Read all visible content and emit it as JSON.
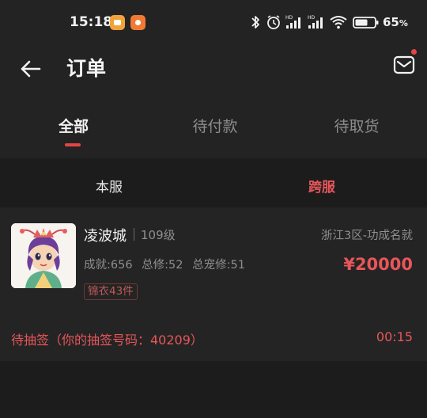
{
  "status_bar": {
    "time": "15:18",
    "battery": "65",
    "icons": [
      "app-notification-icon",
      "app-notification-icon",
      "bluetooth-icon",
      "alarm-icon",
      "hd-signal-icon",
      "hd-signal-icon",
      "wifi-icon",
      "battery-icon"
    ]
  },
  "header": {
    "title": "订单",
    "back_icon": "back-arrow-icon",
    "message_icon": "mail-icon"
  },
  "tabs": [
    {
      "label": "全部",
      "active": true
    },
    {
      "label": "待付款",
      "active": false
    },
    {
      "label": "待取货",
      "active": false
    }
  ],
  "subtabs": [
    {
      "label": "本服",
      "active": false
    },
    {
      "label": "跨服",
      "active": true
    }
  ],
  "order": {
    "seller_name": "凌波城",
    "level": "109级",
    "server": "浙江3区-功成名就",
    "stats": {
      "achievement": "成就:656",
      "total_cultivation": "总修:52",
      "pet_cultivation": "总宠修:51"
    },
    "price": "¥20000",
    "tag": "锦衣43件",
    "status": "待抽签（你的抽签号码：40209）",
    "countdown": "00:15"
  },
  "colors": {
    "accent": "#e8565a",
    "background": "#1c1c1c",
    "card": "#242424"
  }
}
